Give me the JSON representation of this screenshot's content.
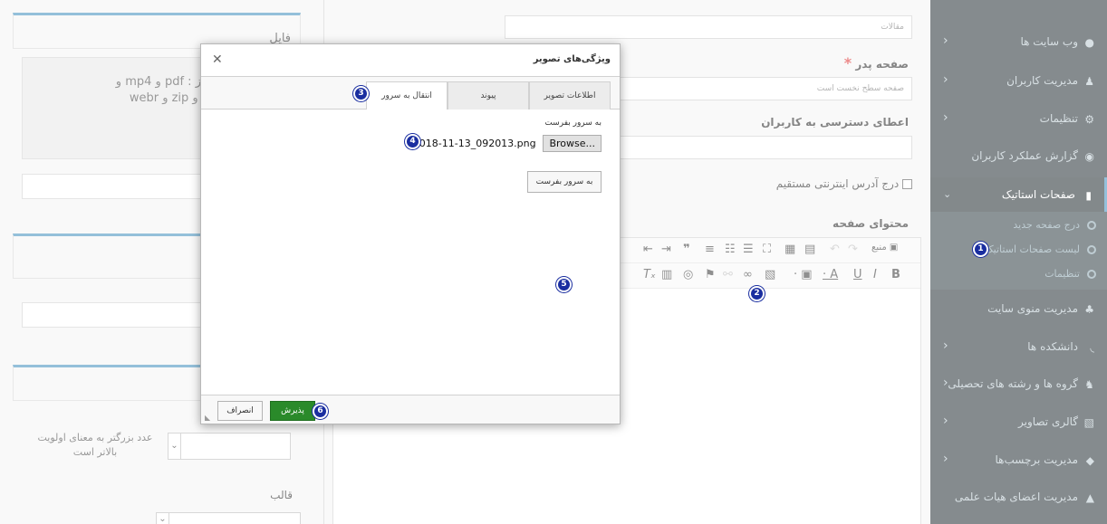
{
  "left_panel": {
    "file_box_title": "فایل",
    "allowed_text_line1": "مجاز عبارت است از : pdf و mp4 و",
    "allowed_text_line2": "docx و doc و rar و zip و webr",
    "priority_text_line1": "عدد بزرگتر به معنای اولویت",
    "priority_text_line2": "بالاتر است",
    "template_label": "قالب"
  },
  "center": {
    "category_value": "مقالات",
    "parent_label": "صفحه پدر",
    "required_mark": "*",
    "parent_value": "صفحه سطح نخست است",
    "access_label": "اعطای دسترسی به کاربران",
    "direct_url_label": "درج آدرس اینترنتی مستقیم",
    "content_label": "محتوای صفحه",
    "source_label": "منبع"
  },
  "sidebar": {
    "items": [
      {
        "label": "وب سایت ها"
      },
      {
        "label": "مدیریت کاربران"
      },
      {
        "label": "تنظیمات"
      },
      {
        "label": "گزارش عملکرد کاربران"
      },
      {
        "label": "صفحات استاتیک"
      },
      {
        "label": "مدیریت منوی سایت"
      },
      {
        "label": "دانشکده ها"
      },
      {
        "label": "گروه ها و رشته های تحصیلی"
      },
      {
        "label": "گالری تصاویر"
      },
      {
        "label": "مدیریت برچسب‌ها"
      },
      {
        "label": "مدیریت اعضای هیات علمی"
      }
    ],
    "sub_items": [
      {
        "label": "درج صفحه جدید"
      },
      {
        "label": "لیست صفحات استاتیک"
      },
      {
        "label": "تنظیمات"
      }
    ]
  },
  "dialog": {
    "title": "ویژگی‌های تصویر",
    "tabs": [
      {
        "label": "اطلاعات تصویر"
      },
      {
        "label": "پیوند"
      },
      {
        "label": "انتقال به سرور"
      }
    ],
    "upload_label": "به سرور بفرست",
    "browse_label": "Browse...",
    "file_name": "2018-11-13_092013.png",
    "send_button": "به سرور بفرست",
    "ok_button": "پذیرش",
    "cancel_button": "انصراف"
  },
  "callouts": [
    "1",
    "2",
    "3",
    "4",
    "5",
    "6"
  ],
  "colors": {
    "sidebar_bg": "#222d32",
    "accent": "#3c8dbc",
    "ok_green": "#2a8a2a",
    "callout_blue": "#1a2ea0"
  }
}
